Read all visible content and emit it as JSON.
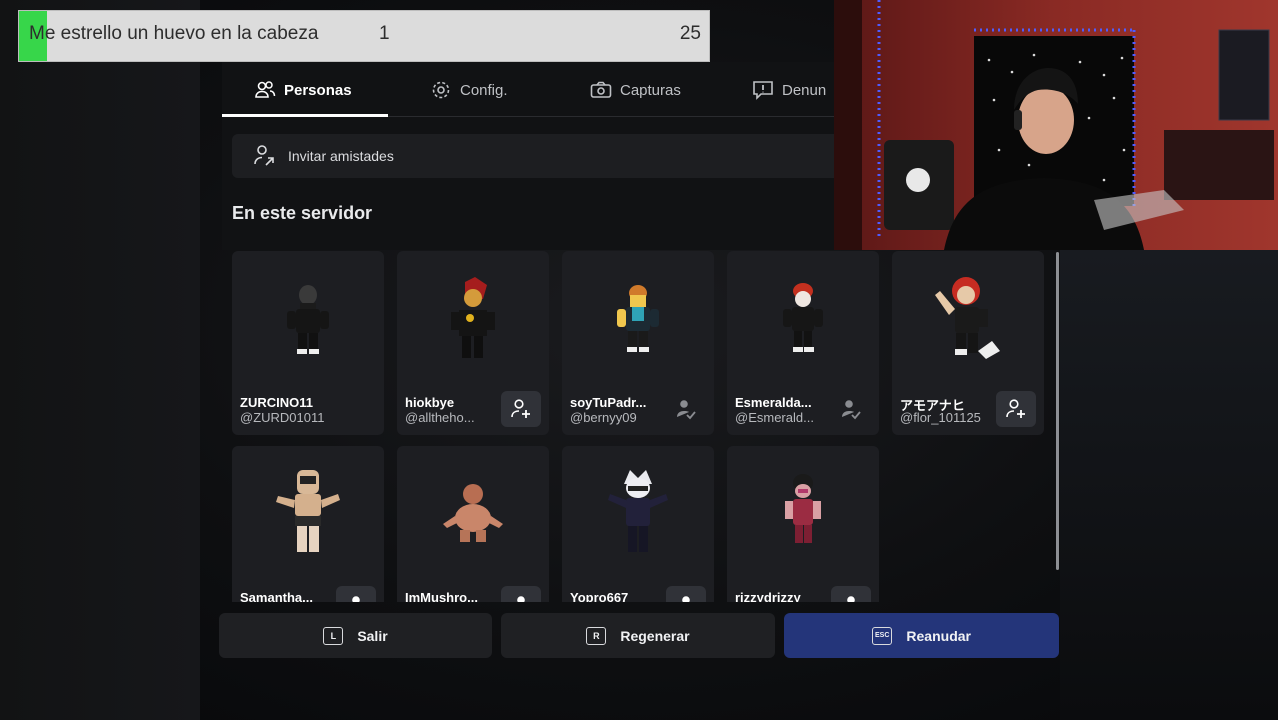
{
  "poll": {
    "text": "Me estrello un huevo en la cabeza",
    "count_a": "1",
    "count_b": "25",
    "fill_fraction": 0.04,
    "fill_color": "#37d64a"
  },
  "tabs": [
    {
      "label": "Personas",
      "icon": "people-icon",
      "active": true
    },
    {
      "label": "Config.",
      "icon": "gear-icon"
    },
    {
      "label": "Capturas",
      "icon": "camera-icon"
    },
    {
      "label": "Denun",
      "icon": "report-icon"
    }
  ],
  "invite": {
    "label": "Invitar amistades",
    "icon": "invite-icon"
  },
  "section_title": "En este servidor",
  "players": [
    {
      "name": "ZURCINO11",
      "handle": "@ZURD01011",
      "action": "none"
    },
    {
      "name": "hiokbye",
      "handle": "@alltheho...",
      "action": "add"
    },
    {
      "name": "soyTuPadr...",
      "handle": "@bernyy09",
      "action": "pending"
    },
    {
      "name": "Esmeralda...",
      "handle": "@Esmerald...",
      "action": "pending"
    },
    {
      "name": "アモアナヒ",
      "handle": "@flor_101125",
      "action": "add"
    },
    {
      "name": "Samantha...",
      "handle": "",
      "action": "pending"
    },
    {
      "name": "ImMushro...",
      "handle": "",
      "action": "pending"
    },
    {
      "name": "Yopro667",
      "handle": "",
      "action": "pending"
    },
    {
      "name": "rizzydrizzy",
      "handle": "",
      "action": "pending"
    }
  ],
  "buttons": [
    {
      "label": "Salir",
      "key": "L"
    },
    {
      "label": "Regenerar",
      "key": "R"
    },
    {
      "label": "Reanudar",
      "key": "ESC"
    }
  ],
  "colors": {
    "primary_button": "#24357a",
    "card_bg": "#1d1e22",
    "panel_bg": "#111214"
  }
}
